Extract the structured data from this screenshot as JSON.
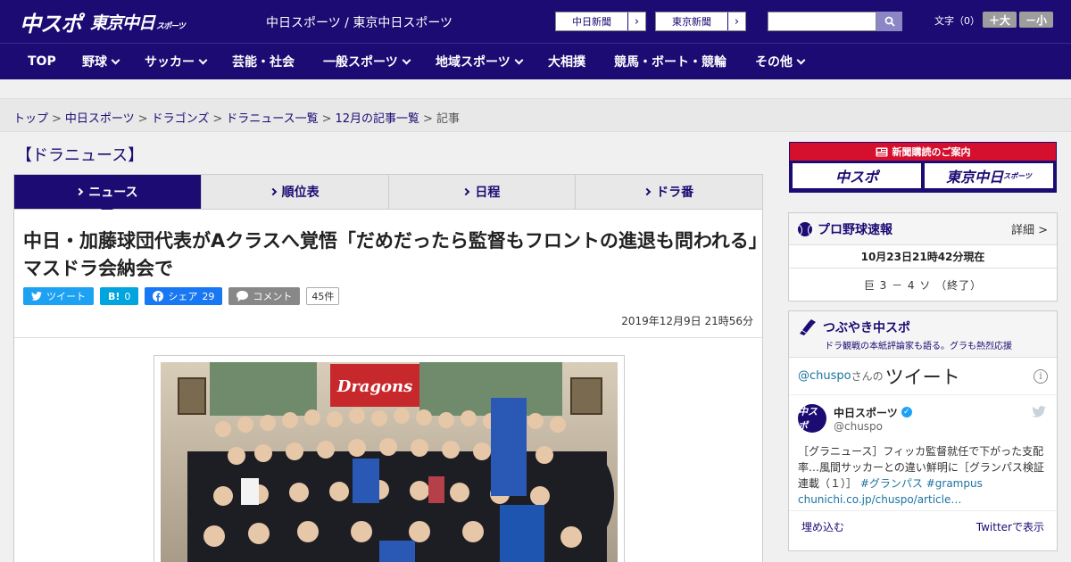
{
  "header": {
    "logo_main": "中スポ",
    "logo_sub": "東京中日",
    "logo_sub_small": "スポーツ",
    "site_title": "中日スポーツ / 東京中日スポーツ",
    "ext_links": [
      "中日新聞",
      "東京新聞"
    ],
    "search_placeholder": "",
    "font_size_label": "文字（0）",
    "font_plus": "＋大",
    "font_minus": "－小"
  },
  "nav": {
    "items": [
      "TOP",
      "野球",
      "サッカー",
      "芸能・社会",
      "一般スポーツ",
      "地域スポーツ",
      "大相撲",
      "競馬・ボート・競輪",
      "その他"
    ]
  },
  "breadcrumb": {
    "items": [
      "トップ",
      "中日スポーツ",
      "ドラゴンズ",
      "ドラニュース一覧",
      "12月の記事一覧"
    ],
    "current": "記事",
    "separator": ">"
  },
  "section_title": "【ドラニュース】",
  "tabs": [
    "ニュース",
    "順位表",
    "日程",
    "ドラ番"
  ],
  "article": {
    "title": "中日・加藤球団代表がAクラスへ覚悟「だめだったら監督もフロントの進退も問われる」マスドラ会納会で",
    "tweet_label": "ツイート",
    "hatena_label": "B!",
    "hatena_count": "0",
    "fb_label": "シェア",
    "fb_count": "29",
    "comment_label": "コメント",
    "comment_count": "45件",
    "date": "2019年12月9日 21時56分",
    "photo_banner": "Dragons"
  },
  "sidebar": {
    "ad_title": "新聞購読のご案内",
    "ad_logos": [
      "中スポ",
      "東京中日"
    ],
    "ad_logo_small": "スポーツ",
    "score_title": "プロ野球速報",
    "score_more": "詳細 >",
    "score_time": "10月23日21時42分現在",
    "score_game": "巨 3 － 4 ソ （終了）",
    "twitter_title": "つぶやき中スポ",
    "twitter_sub": "ドラ観戦の本紙評論家も語る。グラも熱烈応援",
    "embed_handle": "@chuspo",
    "embed_suffix": "さんの",
    "embed_big": "ツイート",
    "tweet_name": "中日スポーツ",
    "tweet_at": "@chuspo",
    "tweet_avatar": "中スポ",
    "tweet_text": "［グラニュース］フィッカ監督就任で下がった支配率…風間サッカーとの違い鮮明に［グランパス検証連載（１）］",
    "tweet_tags": "#グランパス #grampus",
    "tweet_link": "chunichi.co.jp/chuspo/article…",
    "embed_label": "埋め込む",
    "view_label": "Twitterで表示"
  },
  "colors": {
    "brand": "#1b0b73",
    "ad_red": "#d5102f",
    "twitter": "#1da1f2"
  }
}
